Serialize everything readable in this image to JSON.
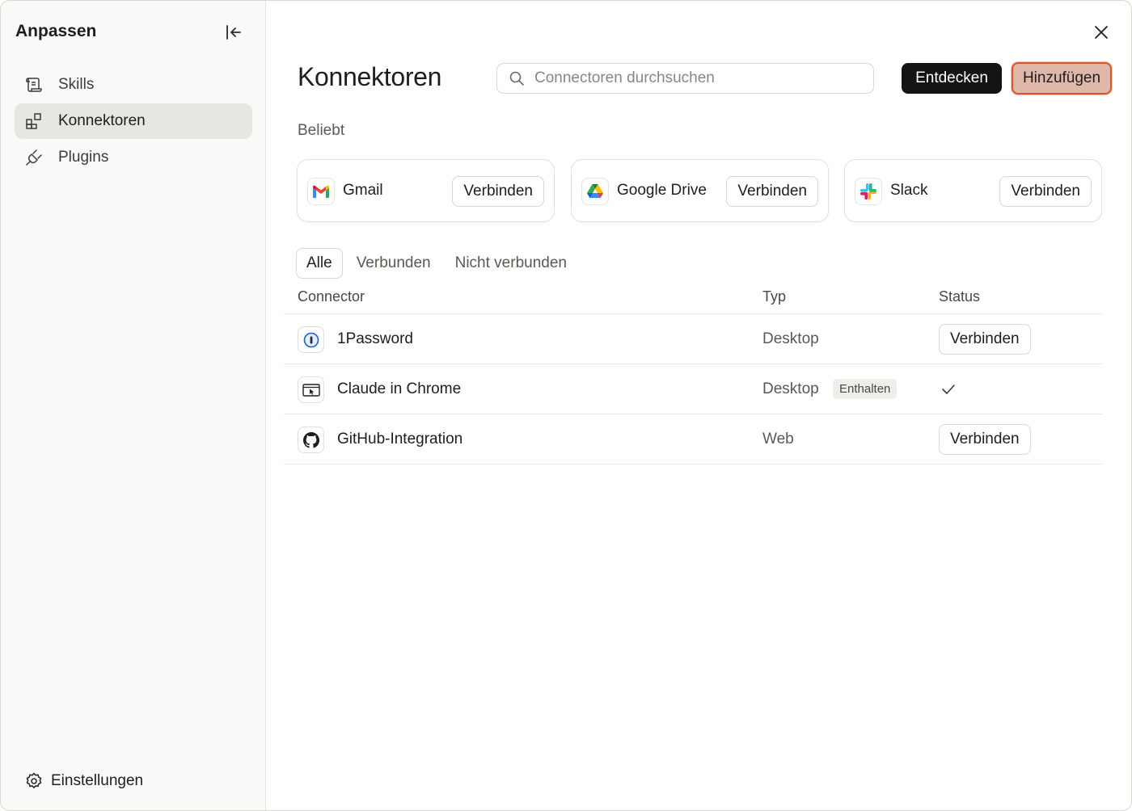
{
  "sidebar": {
    "title": "Anpassen",
    "items": [
      {
        "label": "Skills",
        "icon": "scroll-icon"
      },
      {
        "label": "Konnektoren",
        "icon": "connectors-icon",
        "active": true
      },
      {
        "label": "Plugins",
        "icon": "plug-icon"
      }
    ],
    "settings_label": "Einstellungen"
  },
  "main": {
    "title": "Konnektoren",
    "search": {
      "placeholder": "Connectoren durchsuchen",
      "value": ""
    },
    "discover_label": "Entdecken",
    "add_label": "Hinzufügen",
    "popular_label": "Beliebt",
    "popular": [
      {
        "name": "Gmail",
        "icon": "gmail-icon",
        "button": "Verbinden"
      },
      {
        "name": "Google Drive",
        "icon": "google-drive-icon",
        "button": "Verbinden"
      },
      {
        "name": "Slack",
        "icon": "slack-icon",
        "button": "Verbinden"
      }
    ],
    "tabs": [
      {
        "label": "Alle",
        "active": true
      },
      {
        "label": "Verbunden"
      },
      {
        "label": "Nicht verbunden"
      }
    ],
    "table": {
      "headers": {
        "connector": "Connector",
        "type": "Typ",
        "status": "Status"
      },
      "rows": [
        {
          "name": "1Password",
          "type": "Desktop",
          "icon": "onepassword-icon",
          "status_button": "Verbinden"
        },
        {
          "name": "Claude in Chrome",
          "type": "Desktop",
          "icon": "chrome-extension-icon",
          "badge": "Enthalten",
          "status": "connected"
        },
        {
          "name": "GitHub-Integration",
          "type": "Web",
          "icon": "github-icon",
          "status_button": "Verbinden"
        }
      ]
    }
  },
  "colors": {
    "accent_outline": "#d9552b",
    "primary_button": "#141413"
  }
}
